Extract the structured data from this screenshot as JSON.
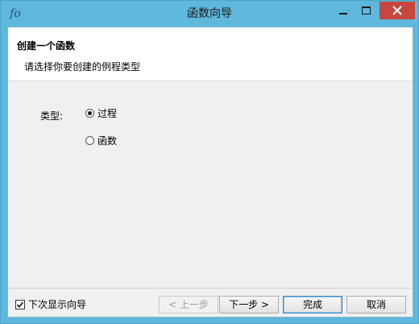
{
  "window": {
    "title": "函数向导",
    "icon": "function-fx-icon",
    "icon_glyph": "fo"
  },
  "header": {
    "title": "创建一个函数",
    "subtitle": "请选择你要创建的例程类型"
  },
  "form": {
    "type_label": "类型:",
    "options": [
      {
        "label": "过程",
        "selected": true
      },
      {
        "label": "函数",
        "selected": false
      }
    ]
  },
  "footer": {
    "show_wizard_next_time": "下次显示向导",
    "show_wizard_checked": true,
    "buttons": {
      "prev": "< 上一步",
      "next": "下一步 >",
      "finish": "完成",
      "cancel": "取消"
    }
  },
  "colors": {
    "title_bar": "#5fb7dc",
    "close_button": "#c7463d",
    "panel_background": "#f0f0f0"
  }
}
